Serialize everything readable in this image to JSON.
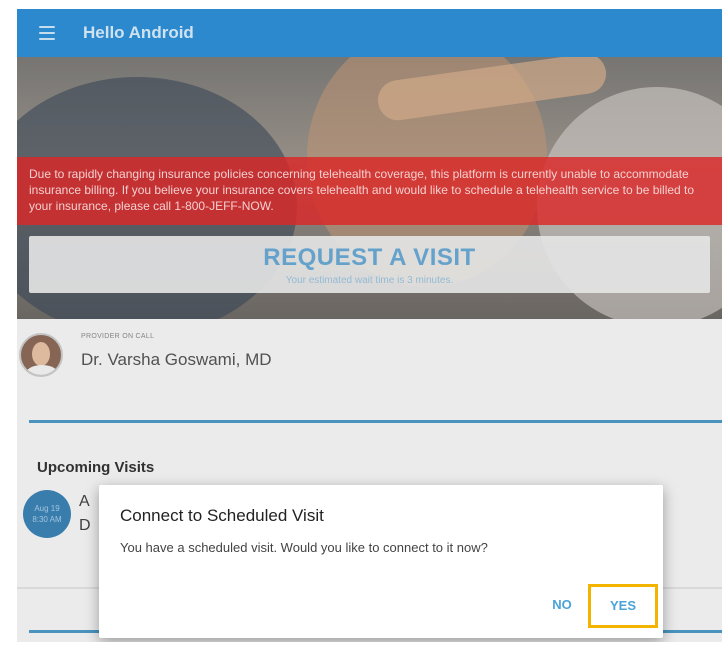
{
  "app": {
    "title": "Hello Android",
    "menu_icon": "menu-icon"
  },
  "banner": {
    "text": "Due to rapidly changing insurance policies concerning telehealth coverage, this platform is currently unable to accommodate insurance billing. If you believe your insurance covers telehealth and would like to schedule a telehealth service to be billed to your insurance, please call 1-800-JEFF-NOW."
  },
  "request": {
    "title": "REQUEST A VISIT",
    "subtitle": "Your estimated wait time is 3 minutes."
  },
  "provider": {
    "label": "PROVIDER ON CALL",
    "name": "Dr. Varsha Goswami, MD"
  },
  "upcoming": {
    "title": "Upcoming Visits",
    "visit": {
      "date": "Aug 19",
      "time": "8:30 AM",
      "line1": "A",
      "line2": "D"
    }
  },
  "dialog": {
    "title": "Connect to Scheduled Visit",
    "message": "You have a scheduled visit. Would you like to connect to it now?",
    "no_label": "NO",
    "yes_label": "YES"
  },
  "colors": {
    "appbar": "#2f8fd6",
    "banner": "#e42a2a",
    "accent": "#4aa3d8",
    "highlight": "#f3b400"
  }
}
